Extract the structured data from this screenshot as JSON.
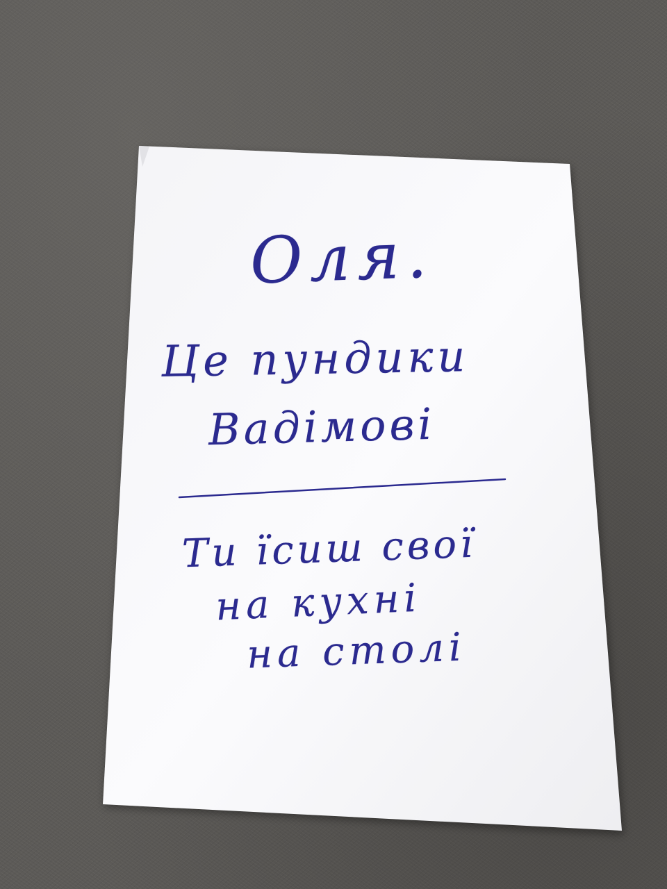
{
  "note": {
    "greeting": "Оля.",
    "lines_top": [
      "Це пундики",
      "Вадімові"
    ],
    "lines_bottom": [
      "Ти їсиш свої",
      "на кухні",
      "на столі"
    ]
  },
  "colors": {
    "ink": "#2b2a8f",
    "paper": "#f7f7f9",
    "background": "#5c5a57"
  }
}
